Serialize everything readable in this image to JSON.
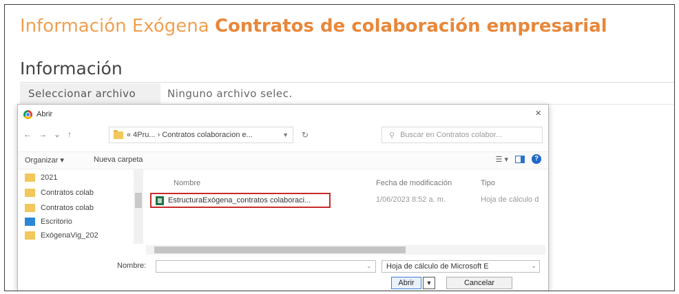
{
  "page": {
    "heading_light": "Información Exógena",
    "heading_bold": "Contratos de colaboración empresarial",
    "section_title": "Información"
  },
  "file_input": {
    "button_label": "Seleccionar archivo",
    "status": "Ninguno archivo selec."
  },
  "dialog": {
    "title": "Abrir",
    "close": "×",
    "nav": {
      "back": "←",
      "forward": "→",
      "recent": "⌄",
      "up": "↑"
    },
    "breadcrumb": "« 4Pru... › Contratos colaboracion e...",
    "refresh": "↻",
    "search_placeholder": "Buscar en Contratos colabor...",
    "commands": {
      "organize": "Organizar ▾",
      "new_folder": "Nueva carpeta"
    },
    "sidebar": [
      {
        "label": "2021",
        "icon": "folder-icon"
      },
      {
        "label": "Contratos colab",
        "icon": "folder-icon"
      },
      {
        "label": "Contratos colab",
        "icon": "folder-icon"
      },
      {
        "label": "Escritorio",
        "icon": "desktop-icon"
      },
      {
        "label": "ExógenaVig_202",
        "icon": "folder-icon"
      }
    ],
    "columns": {
      "name": "Nombre",
      "modified": "Fecha de modificación",
      "type": "Tipo"
    },
    "files": [
      {
        "name": "EstructuraExógena_contratos colaboraci...",
        "modified": "1/06/2023 8:52 a. m.",
        "type": "Hoja de cálculo d",
        "icon": "excel-file-icon"
      }
    ],
    "file_name_label": "Nombre:",
    "file_name_value": "",
    "file_type": "Hoja de cálculo de Microsoft E",
    "open_button": "Abrir",
    "cancel_button": "Cancelar"
  },
  "colors": {
    "heading_orange": "#e8873a",
    "highlight_red": "#c82a2a",
    "selection_blue": "#3c7fd4"
  }
}
